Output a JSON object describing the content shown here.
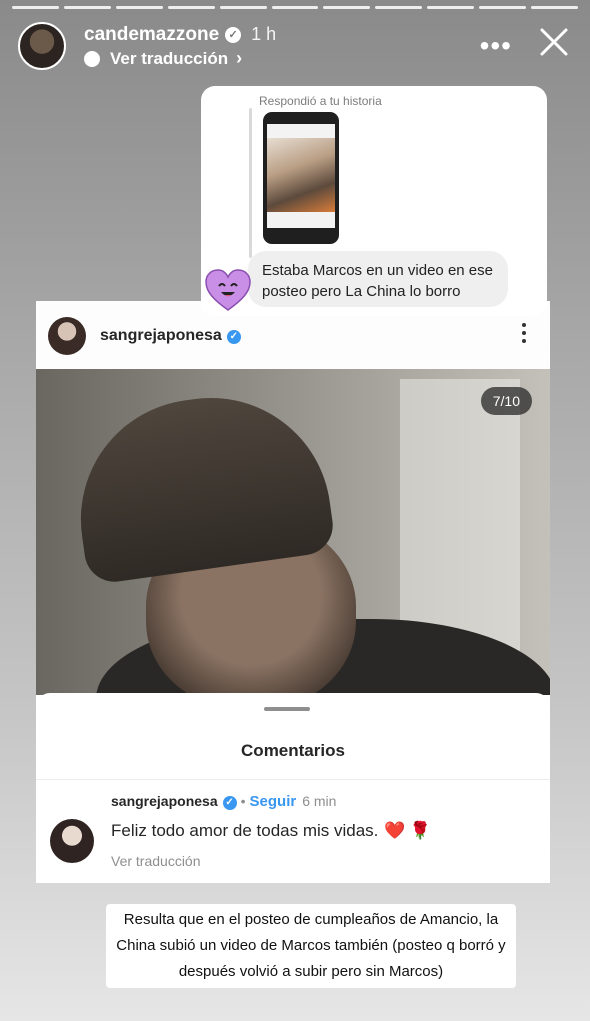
{
  "story": {
    "segments": 11,
    "username": "candemazzone",
    "time": "1 h",
    "translate": "Ver traducción"
  },
  "reply": {
    "label": "Respondió a tu historia",
    "message": "Estaba Marcos en un video en ese posteo pero La China lo borro"
  },
  "post": {
    "username": "sangrejaponesa",
    "slide_counter": "7/10"
  },
  "comments": {
    "title": "Comentarios",
    "items": [
      {
        "username": "sangrejaponesa",
        "follow": "Seguir",
        "time": "6 min",
        "text": "Feliz todo amor de todas mis vidas.",
        "heart": "❤️",
        "rose": "🌹",
        "translate": "Ver traducción"
      }
    ]
  },
  "caption": "Resulta que en el posteo de cumpleaños de Amancio, la China subió un video de Marcos también (posteo q borró y después volvió a subir pero sin Marcos)",
  "colors": {
    "verified": "#3897f0",
    "heart": "#e0245e"
  }
}
